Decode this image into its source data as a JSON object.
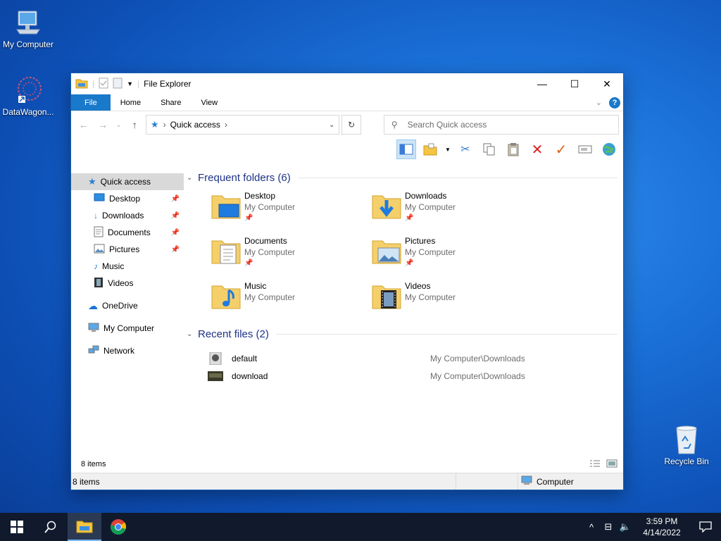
{
  "desktop": {
    "icons": [
      {
        "label": "My Computer",
        "icon": "monitor-icon"
      },
      {
        "label": "DataWagon...",
        "icon": "shortcut-icon"
      },
      {
        "label": "Recycle Bin",
        "icon": "recycle-bin-icon"
      }
    ]
  },
  "window": {
    "title": "File Explorer",
    "tabs": [
      "File",
      "Home",
      "Share",
      "View"
    ],
    "address": {
      "location": "Quick access"
    },
    "search": {
      "placeholder": "Search Quick access"
    },
    "sidebar": {
      "items": [
        {
          "label": "Quick access",
          "icon": "star-icon"
        },
        {
          "label": "Desktop",
          "icon": "desktop-icon",
          "pinned": true
        },
        {
          "label": "Downloads",
          "icon": "download-icon",
          "pinned": true
        },
        {
          "label": "Documents",
          "icon": "document-icon",
          "pinned": true
        },
        {
          "label": "Pictures",
          "icon": "picture-icon",
          "pinned": true
        },
        {
          "label": "Music",
          "icon": "music-icon"
        },
        {
          "label": "Videos",
          "icon": "video-icon"
        },
        {
          "label": "OneDrive",
          "icon": "cloud-icon"
        },
        {
          "label": "My Computer",
          "icon": "computer-icon"
        },
        {
          "label": "Network",
          "icon": "network-icon"
        }
      ]
    },
    "frequent": {
      "heading": "Frequent folders (6)",
      "folders": [
        {
          "name": "Desktop",
          "location": "My Computer"
        },
        {
          "name": "Downloads",
          "location": "My Computer"
        },
        {
          "name": "Documents",
          "location": "My Computer"
        },
        {
          "name": "Pictures",
          "location": "My Computer"
        },
        {
          "name": "Music",
          "location": "My Computer"
        },
        {
          "name": "Videos",
          "location": "My Computer"
        }
      ]
    },
    "recent": {
      "heading": "Recent files (2)",
      "files": [
        {
          "name": "default",
          "path": "My Computer\\Downloads"
        },
        {
          "name": "download",
          "path": "My Computer\\Downloads"
        }
      ]
    },
    "status": {
      "items_line": "8 items",
      "items_bar": "8 items",
      "location": "Computer"
    }
  },
  "taskbar": {
    "time": "3:59 PM",
    "date": "4/14/2022"
  },
  "colors": {
    "accent": "#1979ca",
    "heading": "#1e3287",
    "taskbar": "#101a2c"
  }
}
